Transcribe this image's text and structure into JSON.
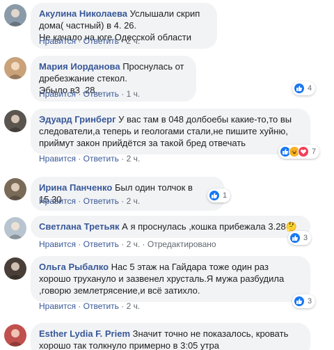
{
  "comments": [
    {
      "author": "Акулина Николаева",
      "lines": [
        "Услышали скрип дома( частный) в 4. 26.",
        "Не качало на юге Одесской области"
      ],
      "like": "Нравится",
      "reply": "Ответить",
      "time": "2 ч.",
      "edited": "",
      "reactions": {
        "icons": [],
        "count": ""
      },
      "avatar_color": "#8a9aa8"
    },
    {
      "author": "Мария Иорданова",
      "lines": [
        "Проснулась от дребезжание стекол.",
        "Эбыло в3 .28.."
      ],
      "like": "Нравится",
      "reply": "Ответить",
      "time": "1 ч.",
      "edited": "",
      "reactions": {
        "icons": [
          "like"
        ],
        "count": "4"
      },
      "avatar_color": "#c9a27a"
    },
    {
      "author": "Эдуард Гринберг",
      "lines": [
        "У вас там в 048 долбоебы какие-то,то вы",
        "следователи,а теперь и геологами стали,не пишите хуйню,",
        "приймут закон прийдётся за такой бред отвечать"
      ],
      "like": "Нравится",
      "reply": "Ответить",
      "time": "2 ч.",
      "edited": "",
      "reactions": {
        "icons": [
          "like",
          "haha",
          "love"
        ],
        "count": "7"
      },
      "avatar_color": "#5b5550"
    },
    {
      "author": "Ирина Панченко",
      "lines": [
        "Был один толчок в 15.30"
      ],
      "like": "Нравится",
      "reply": "Ответить",
      "time": "2 ч.",
      "edited": "",
      "reactions": {
        "icons": [
          "like"
        ],
        "count": "1"
      },
      "avatar_color": "#7a6a58"
    },
    {
      "author": "Светлана Третьяк",
      "lines": [
        "А я проснулась ,кошка прибежала 3.28🤔"
      ],
      "like": "Нравится",
      "reply": "Ответить",
      "time": "2 ч.",
      "edited": "Отредактировано",
      "reactions": {
        "icons": [
          "like"
        ],
        "count": "3"
      },
      "avatar_color": "#b8c4d0"
    },
    {
      "author": "Ольга Рыбалко",
      "lines": [
        "Нас 5 этаж на Гайдара тоже один раз",
        "хорошо трухануло и зазвенел хрусталь.Я мужа разбудила",
        ",говорю землетрясение,и всё затихло."
      ],
      "like": "Нравится",
      "reply": "Ответить",
      "time": "2 ч.",
      "edited": "",
      "reactions": {
        "icons": [
          "like"
        ],
        "count": "3"
      },
      "avatar_color": "#4a3f38"
    },
    {
      "author": "Esther Lydia F. Priem",
      "lines": [
        "Значит точно не показалось, кровать",
        "хорошо так толкнуло примерно в 3:05 утра"
      ],
      "like": "",
      "reply": "",
      "time": "",
      "edited": "",
      "reactions": {
        "icons": [],
        "count": ""
      },
      "avatar_color": "#c0504d"
    }
  ]
}
